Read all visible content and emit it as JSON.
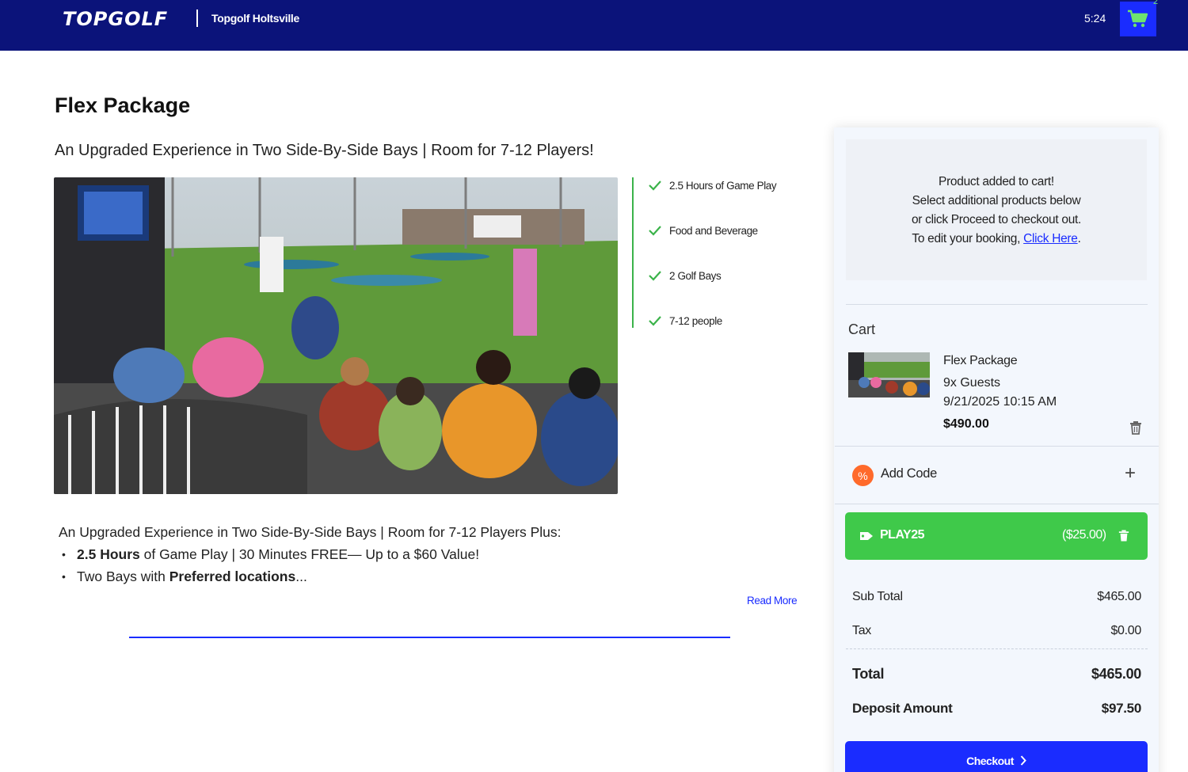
{
  "header": {
    "brand": "TOPGOLF",
    "venue": "Topgolf Holtsville",
    "timer": "5:24",
    "cart_count": "2",
    "cart_icon": "shopping-cart-icon",
    "background": "#0b137a"
  },
  "product": {
    "title": "Flex Package",
    "subtitle": "An Upgraded Experience in Two Side-By-Side Bays | Room for 7-12 Players!",
    "image_alt": "photo-of-group-at-golf-bays",
    "features": [
      "2.5 Hours of Game Play",
      "Food and Beverage",
      "2 Golf Bays",
      "7-12 people"
    ],
    "description": {
      "intro": "An Upgraded Experience in Two Side-By-Side Bays | Room for 7-12 Players Plus:",
      "bullet1_bold": "2.5 Hours",
      "bullet1_rest": " of Game Play | 30 Minutes FREE— Up to a $60 Value!",
      "bullet2_pre": "Two Bays with ",
      "bullet2_bold": "Preferred locations",
      "bullet2_post": "..."
    },
    "read_more": "Read More"
  },
  "notice": {
    "line1": "Product added to cart!",
    "line2": "Select additional products below",
    "line3": "or click Proceed to checkout out.",
    "line4_pre": "To edit your booking, ",
    "line4_link": "Click Here",
    "line4_post": "."
  },
  "cart": {
    "heading": "Cart",
    "item": {
      "name": "Flex Package",
      "guests": "9x Guests",
      "datetime": "9/21/2025 10:15 AM",
      "price": "$490.00"
    },
    "add_code_label": "Add Code",
    "promo": {
      "code": "PLAY25",
      "amount": "($25.00)",
      "color": "#3fc94a"
    },
    "summary": {
      "subtotal_label": "Sub Total",
      "subtotal": "$465.00",
      "tax_label": "Tax",
      "tax": "$0.00",
      "total_label": "Total",
      "total": "$465.00",
      "deposit_label": "Deposit Amount",
      "deposit": "$97.50"
    },
    "checkout_label": "Checkout",
    "accent": "#1a2cff"
  }
}
